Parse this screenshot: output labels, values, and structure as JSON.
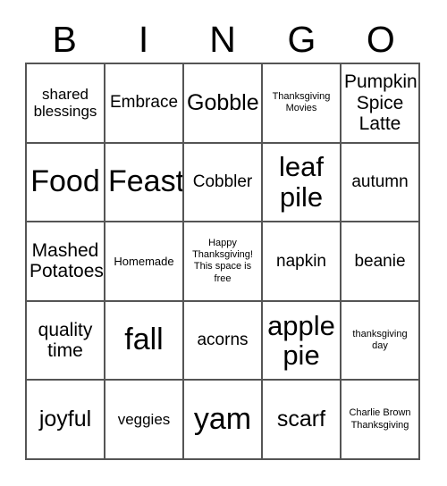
{
  "header": {
    "letters": [
      "B",
      "I",
      "N",
      "G",
      "O"
    ]
  },
  "grid": {
    "rows": 5,
    "columns": 5,
    "border_color": "#555555",
    "background_color": "#ffffff",
    "text_color": "#000000",
    "cells": [
      {
        "text": "shared blessings",
        "size": "m",
        "free": false
      },
      {
        "text": "Embrace",
        "size": "ml",
        "free": false
      },
      {
        "text": "Gobble",
        "size": "xl",
        "free": false
      },
      {
        "text": "Thanksgiving Movies",
        "size": "xs",
        "free": false
      },
      {
        "text": "Pumpkin Spice Latte",
        "size": "l",
        "free": false
      },
      {
        "text": "Food",
        "size": "hg",
        "free": false
      },
      {
        "text": "Feast",
        "size": "hg",
        "free": false
      },
      {
        "text": "Cobbler",
        "size": "ml",
        "free": false
      },
      {
        "text": "leaf pile",
        "size": "xxl",
        "free": false
      },
      {
        "text": "autumn",
        "size": "ml",
        "free": false
      },
      {
        "text": "Mashed Potatoes",
        "size": "l",
        "free": false
      },
      {
        "text": "Homemade",
        "size": "s",
        "free": false
      },
      {
        "text": "Happy Thanksgiving! This space is free",
        "size": "xs",
        "free": true
      },
      {
        "text": "napkin",
        "size": "ml",
        "free": false
      },
      {
        "text": "beanie",
        "size": "ml",
        "free": false
      },
      {
        "text": "quality time",
        "size": "l",
        "free": false
      },
      {
        "text": "fall",
        "size": "hg",
        "free": false
      },
      {
        "text": "acorns",
        "size": "ml",
        "free": false
      },
      {
        "text": "apple pie",
        "size": "xxl",
        "free": false
      },
      {
        "text": "thanksgiving day",
        "size": "xs",
        "free": false
      },
      {
        "text": "joyful",
        "size": "xl",
        "free": false
      },
      {
        "text": "veggies",
        "size": "m",
        "free": false
      },
      {
        "text": "yam",
        "size": "hg",
        "free": false
      },
      {
        "text": "scarf",
        "size": "xl",
        "free": false
      },
      {
        "text": "Charlie Brown Thanksgiving",
        "size": "xs",
        "free": false
      }
    ]
  }
}
